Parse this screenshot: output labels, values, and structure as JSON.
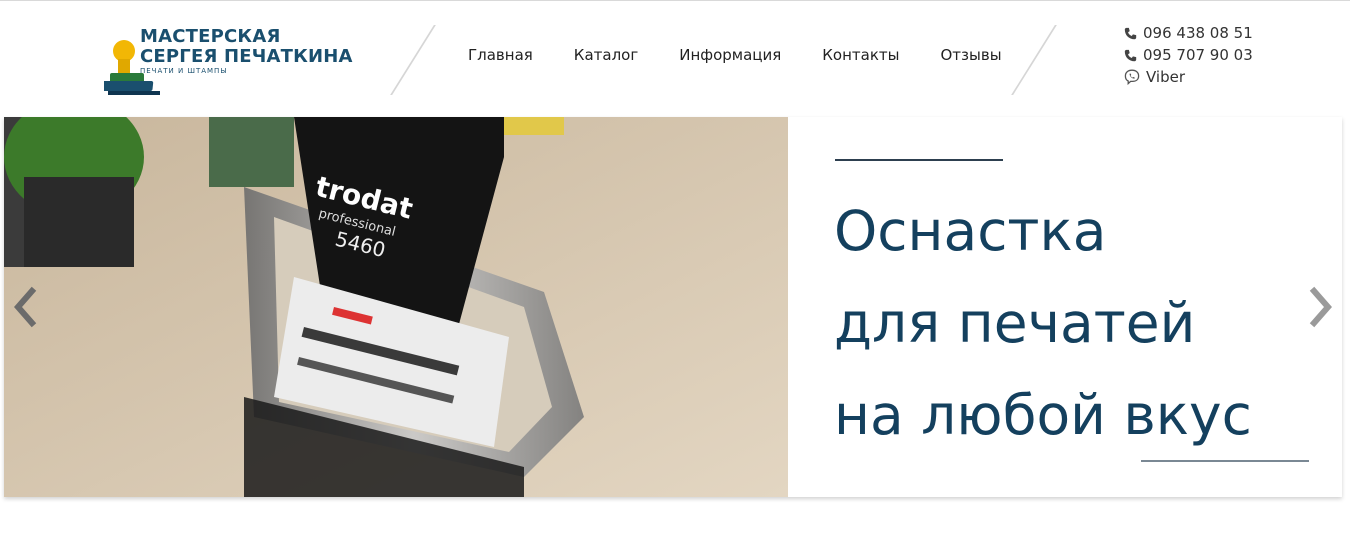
{
  "brand": {
    "title_line1": "МАСТЕРСКАЯ",
    "title_line2": "СЕРГЕЯ ПЕЧАТКИНА",
    "subtitle": "ПЕЧАТИ И ШТАМПЫ"
  },
  "nav": [
    {
      "label": "Главная"
    },
    {
      "label": "Каталог"
    },
    {
      "label": "Информация"
    },
    {
      "label": "Контакты"
    },
    {
      "label": "Отзывы"
    }
  ],
  "contacts": [
    {
      "icon": "phone-icon",
      "text": "096 438 08 51"
    },
    {
      "icon": "phone-icon",
      "text": "095 707 90 03"
    },
    {
      "icon": "viber-icon",
      "text": "Viber"
    }
  ],
  "slide": {
    "headline_line1": "Оснастка",
    "headline_line2": "для печатей",
    "headline_line3": "на любой вкус",
    "photo_label_brand": "trodat",
    "photo_label_series": "professional",
    "photo_label_model": "5460"
  },
  "colors": {
    "brand_blue": "#1a4f6e",
    "headline": "#14405e",
    "logo_yellow": "#f2b705"
  }
}
